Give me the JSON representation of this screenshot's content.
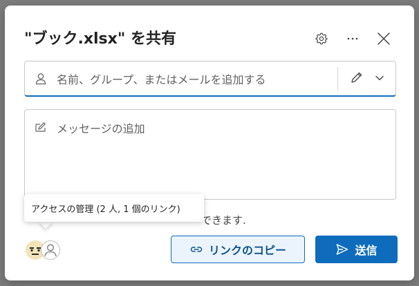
{
  "dialog": {
    "title": "\"ブック.xlsx\" を共有"
  },
  "header": {
    "settings_icon": "gear-icon",
    "more_icon": "more-ellipsis-icon",
    "close_icon": "close-icon"
  },
  "people_input": {
    "placeholder": "名前、グループ、またはメールを追加する",
    "value": "",
    "person_icon": "person-icon",
    "permission_icon": "pencil-icon",
    "dropdown_icon": "chevron-down-icon"
  },
  "message_input": {
    "placeholder": "メッセージの追加",
    "value": "",
    "icon": "edit-message-icon"
  },
  "hint": {
    "text": "できます."
  },
  "tooltip": {
    "text": "アクセスの管理 (2 人, 1 個のリンク)"
  },
  "actions": {
    "copy_link_label": "リンクのコピー",
    "send_label": "送信"
  },
  "colors": {
    "accent": "#0f6cbd",
    "copy_bg": "#ebf3fc",
    "copy_text": "#0f548c"
  }
}
